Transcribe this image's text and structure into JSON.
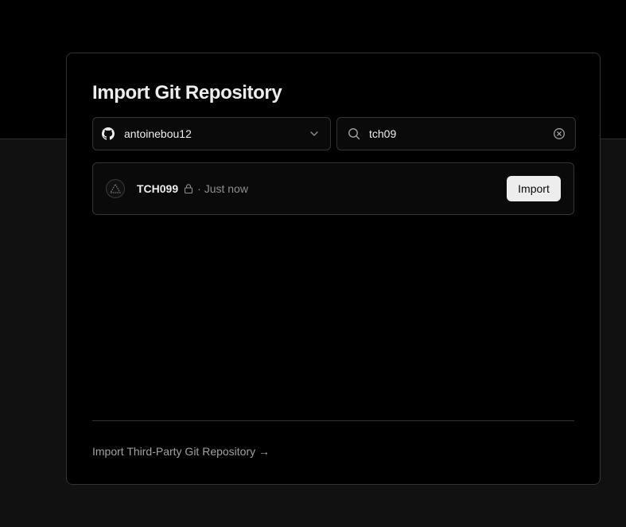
{
  "dialog": {
    "title": "Import Git Repository"
  },
  "scope_select": {
    "icon": "github-icon",
    "value": "antoinebou12",
    "chevron_icon": "chevron-down-icon"
  },
  "search": {
    "icon": "search-icon",
    "value": "tch09",
    "clear_icon": "clear-circle-x-icon"
  },
  "results": [
    {
      "avatar_icon": "triangle-logo-icon",
      "name": "TCH099",
      "lock_icon": "lock-icon",
      "meta": "· Just now",
      "action_label": "Import"
    }
  ],
  "footer": {
    "third_party_link": "Import Third-Party Git Repository →"
  },
  "colors": {
    "background": "#111111",
    "card": "#000000",
    "border": "#333333",
    "text": "#ededed",
    "muted": "#8f8f8f",
    "button_bg": "#ededed"
  }
}
